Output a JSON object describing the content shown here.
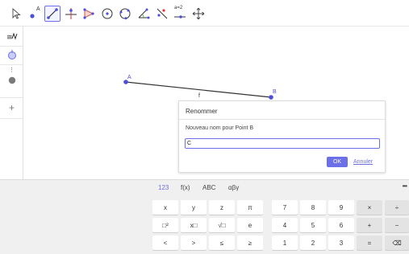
{
  "toolbar": {
    "tools": [
      {
        "name": "move-tool",
        "active": false
      },
      {
        "name": "point-tool",
        "label": "A",
        "active": false
      },
      {
        "name": "segment-tool",
        "active": true
      },
      {
        "name": "perpendicular-tool",
        "active": false
      },
      {
        "name": "polygon-tool",
        "active": false
      },
      {
        "name": "circle-center-point-tool",
        "active": false
      },
      {
        "name": "circle-three-points-tool",
        "active": false
      },
      {
        "name": "angle-tool",
        "active": false
      },
      {
        "name": "reflect-tool",
        "active": false
      },
      {
        "name": "slider-tool",
        "label": "a=2",
        "active": false
      },
      {
        "name": "move-graphics-view-tool",
        "active": false
      }
    ]
  },
  "side": {
    "icons": [
      "algebra-view-icon",
      "rename-icon",
      "more-icon",
      "add-icon"
    ]
  },
  "graphics": {
    "point_a_label": "A",
    "point_b_label": "B",
    "segment_label": "f"
  },
  "dialog": {
    "title": "Renommer",
    "prompt": "Nouveau nom pour Point B",
    "input_value": "C",
    "ok_label": "OK",
    "cancel_label": "Annuler"
  },
  "keyboard": {
    "tabs": [
      "123",
      "f(x)",
      "ABC",
      "αβγ"
    ],
    "active_tab": "123",
    "more_label": "•••",
    "rows": [
      [
        "x",
        "y",
        "z",
        "π",
        "7",
        "8",
        "9",
        "×",
        "÷"
      ],
      [
        "□²",
        "x□",
        "√□",
        "e",
        "4",
        "5",
        "6",
        "+",
        "−"
      ],
      [
        "<",
        ">",
        "≤",
        "≥",
        "1",
        "2",
        "3",
        "=",
        "⌫"
      ]
    ]
  },
  "colors": {
    "accent": "#6b6fe8",
    "point": "#4c4fd9",
    "segment": "#333333"
  }
}
